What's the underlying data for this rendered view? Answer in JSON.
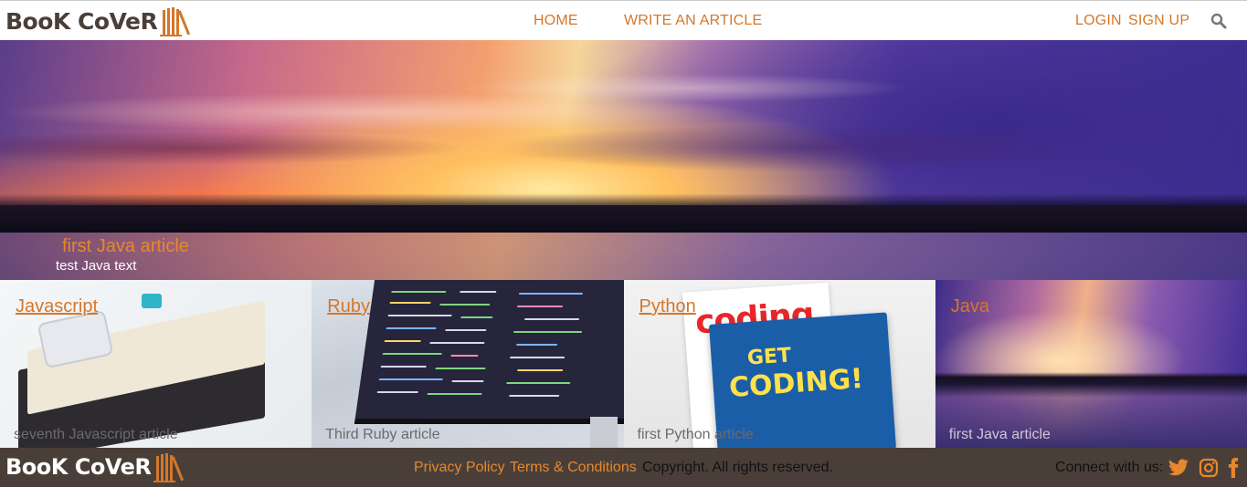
{
  "brand": {
    "logo_text": "BooK CoVeR"
  },
  "nav": {
    "home": "HOME",
    "write": "WRITE AN ARTICLE",
    "login": "LOGIN",
    "signup": "SIGN UP"
  },
  "hero": {
    "title": "first Java article",
    "text": "test Java text"
  },
  "categories": [
    {
      "name": "Javascript",
      "article": "seventh Javascript article"
    },
    {
      "name": "Ruby",
      "article": "Third Ruby article"
    },
    {
      "name": "Python",
      "article": "first Python article"
    },
    {
      "name": "Java",
      "article": "first Java article"
    }
  ],
  "python_cover": {
    "top_word": "coding",
    "get": "GET",
    "coding": "CODING!"
  },
  "footer": {
    "logo_text": "BooK CoVeR",
    "privacy": "Privacy Policy",
    "terms": "Terms & Conditions",
    "copyright": "Copyright. All rights reserved.",
    "connect": "Connect with us:"
  },
  "colors": {
    "accent": "#d4772a",
    "footer_bg": "#4a3f38",
    "text_dark": "#4a3f38"
  },
  "icons": [
    "books-icon",
    "search-icon",
    "twitter-icon",
    "instagram-icon",
    "facebook-icon"
  ]
}
